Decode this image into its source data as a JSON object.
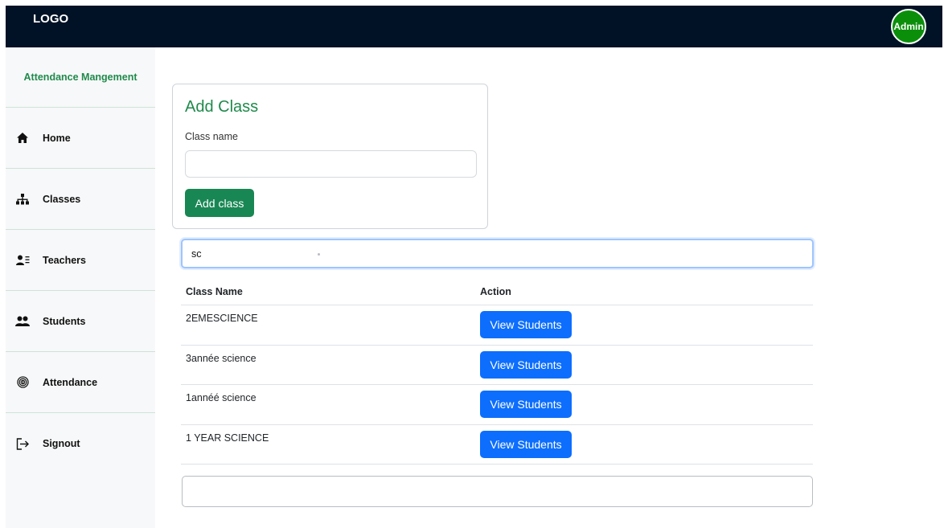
{
  "header": {
    "logo": "LOGO",
    "avatar_label": "Admin"
  },
  "sidebar": {
    "title": "Attendance Mangement",
    "items": [
      {
        "label": "Home",
        "icon": "home-icon"
      },
      {
        "label": "Classes",
        "icon": "sitemap-icon"
      },
      {
        "label": "Teachers",
        "icon": "teacher-list-icon"
      },
      {
        "label": "Students",
        "icon": "users-icon"
      },
      {
        "label": "Attendance",
        "icon": "fingerprint-icon"
      },
      {
        "label": "Signout",
        "icon": "signout-icon"
      }
    ]
  },
  "add_class": {
    "title": "Add Class",
    "field_label": "Class name",
    "input_value": "",
    "button_label": "Add class"
  },
  "search": {
    "value": "sc"
  },
  "table": {
    "headers": [
      "Class Name",
      "Action"
    ],
    "rows": [
      {
        "name": "2EMESCIENCE",
        "action": "View Students"
      },
      {
        "name": "3année science",
        "action": "View Students"
      },
      {
        "name": "1annéé science",
        "action": "View Students"
      },
      {
        "name": "1 YEAR SCIENCE",
        "action": "View Students"
      }
    ]
  },
  "colors": {
    "navbar": "#021226",
    "accent_green": "#198754",
    "primary_blue": "#0d6efd",
    "avatar": "#0b8f0b"
  }
}
